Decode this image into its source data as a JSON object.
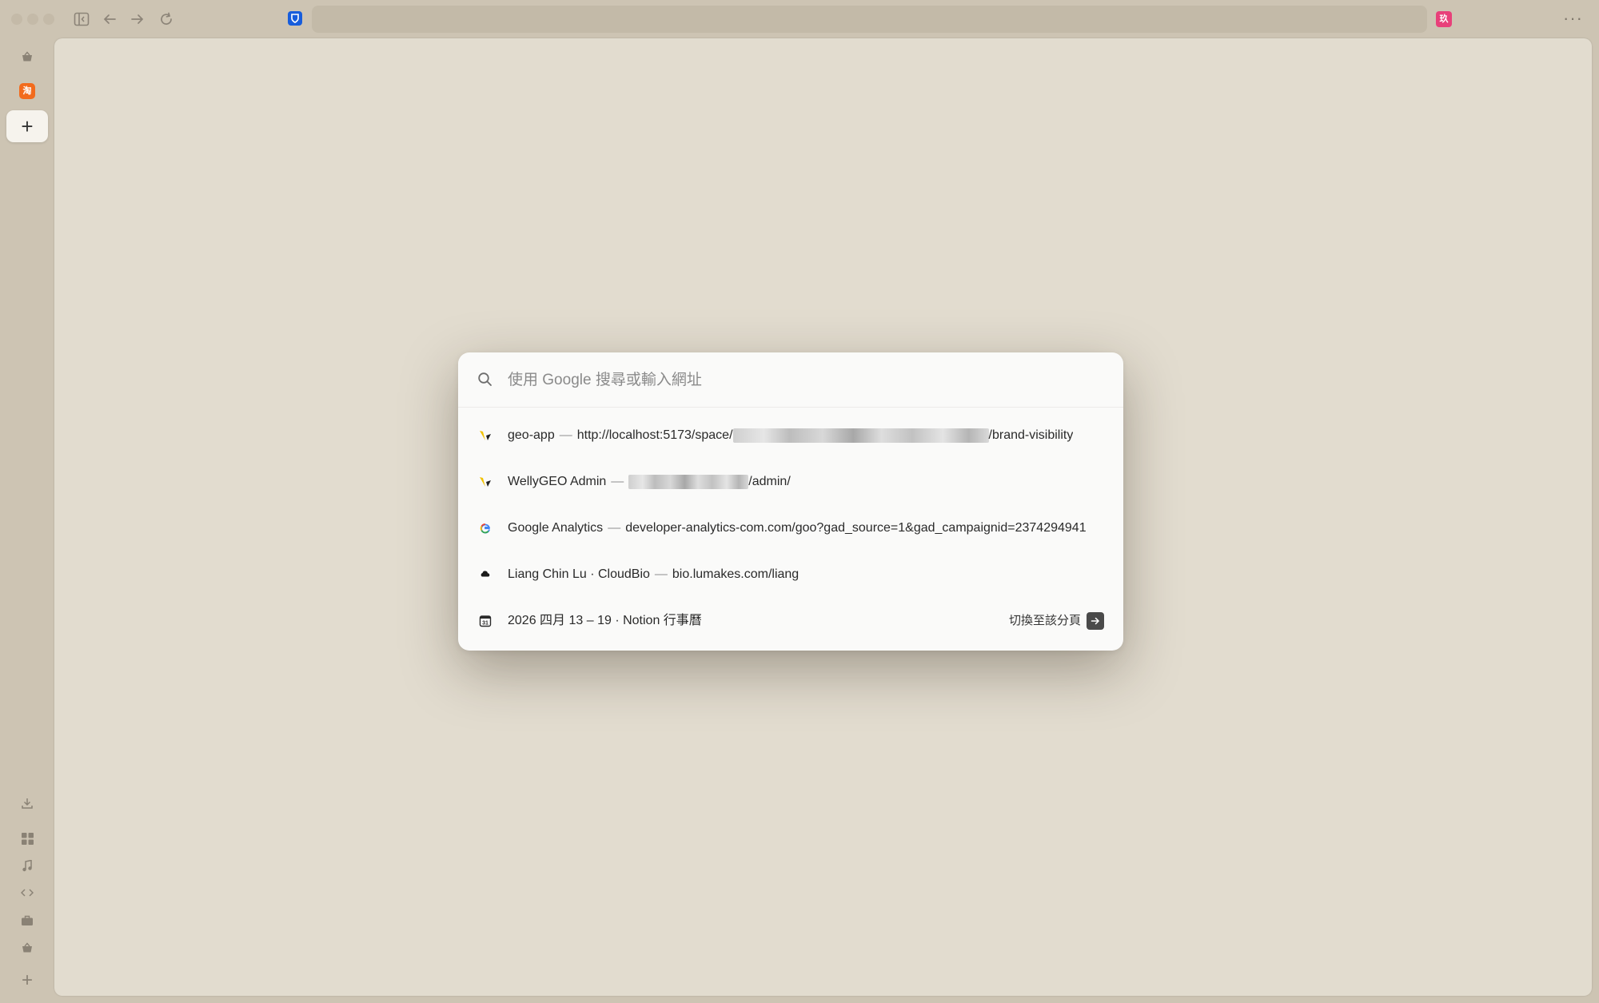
{
  "toolbar": {
    "extension_pink_glyph": "玖"
  },
  "sidebar": {
    "pinned_tab_glyph": "淘",
    "new_tab_label": "+",
    "bottom_add_label": "+"
  },
  "palette": {
    "search_placeholder": "使用 Google 搜尋或輸入網址",
    "items": [
      {
        "title": "geo-app",
        "url_prefix": "http://localhost:5173/space/",
        "url_suffix": "/brand-visibility",
        "icon": "geo-app-favicon"
      },
      {
        "title": "WellyGEO Admin",
        "url_prefix": "",
        "url_suffix": "/admin/",
        "icon": "wellygeo-favicon"
      },
      {
        "title": "Google Analytics",
        "url_prefix": "developer-analytics-com.com/goo?gad_source=1&gad_campaignid=2374294941",
        "url_suffix": "",
        "icon": "google-favicon"
      },
      {
        "title": "Liang Chin Lu · CloudBio",
        "url_prefix": "bio.lumakes.com/liang",
        "url_suffix": "",
        "icon": "cloudbio-favicon"
      },
      {
        "title": "2026 四月 13 – 19 · Notion 行事曆",
        "url_prefix": "",
        "url_suffix": "",
        "icon": "notion-calendar-favicon",
        "action_label": "切換至該分頁"
      }
    ]
  },
  "colors": {
    "window_frame": "#cdc4b3",
    "content_bg": "#e2dccf",
    "palette_bg": "#fafaf9",
    "bitwarden_blue": "#175ddc",
    "extension_pink": "#e8407a",
    "pinned_orange": "#f26b1d"
  }
}
